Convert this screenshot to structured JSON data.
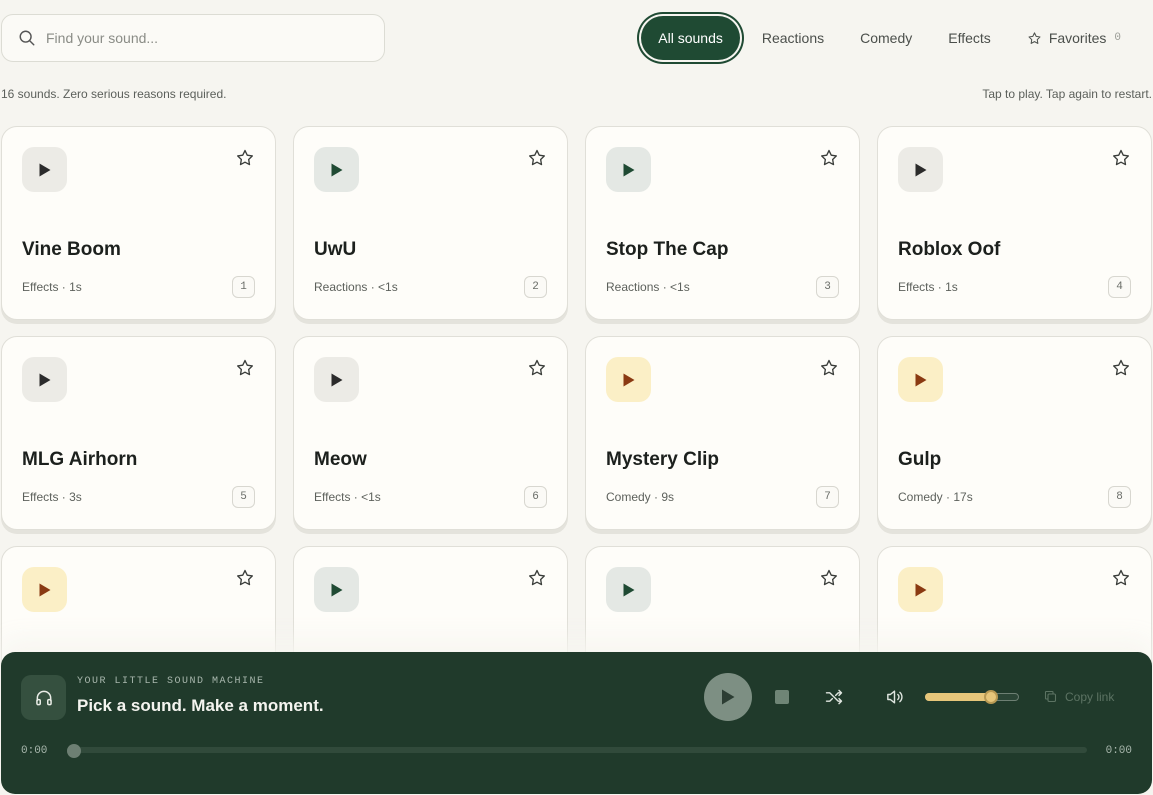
{
  "search": {
    "placeholder": "Find your sound..."
  },
  "filters": [
    {
      "label": "All sounds",
      "active": true
    },
    {
      "label": "Reactions",
      "active": false
    },
    {
      "label": "Comedy",
      "active": false
    },
    {
      "label": "Effects",
      "active": false
    }
  ],
  "favorites": {
    "label": "Favorites",
    "count": "0"
  },
  "summary": "16 sounds. Zero serious reasons required.",
  "hint": "Tap to play. Tap again to restart.",
  "cards": [
    {
      "name": "Vine Boom",
      "meta": "Effects · 1s",
      "index": "1",
      "tone": "grey"
    },
    {
      "name": "UwU",
      "meta": "Reactions · <1s",
      "index": "2",
      "tone": "green"
    },
    {
      "name": "Stop The Cap",
      "meta": "Reactions · <1s",
      "index": "3",
      "tone": "green"
    },
    {
      "name": "Roblox Oof",
      "meta": "Effects · 1s",
      "index": "4",
      "tone": "grey"
    },
    {
      "name": "MLG Airhorn",
      "meta": "Effects · 3s",
      "index": "5",
      "tone": "grey"
    },
    {
      "name": "Meow",
      "meta": "Effects · <1s",
      "index": "6",
      "tone": "grey"
    },
    {
      "name": "Mystery Clip",
      "meta": "Comedy · 9s",
      "index": "7",
      "tone": "gold"
    },
    {
      "name": "Gulp",
      "meta": "Comedy · 17s",
      "index": "8",
      "tone": "gold"
    },
    {
      "name": "",
      "meta": "",
      "index": "",
      "tone": "gold"
    },
    {
      "name": "",
      "meta": "",
      "index": "",
      "tone": "green"
    },
    {
      "name": "",
      "meta": "",
      "index": "",
      "tone": "green"
    },
    {
      "name": "",
      "meta": "",
      "index": "",
      "tone": "gold"
    }
  ],
  "player": {
    "kicker": "YOUR LITTLE SOUND MACHINE",
    "tagline": "Pick a sound. Make a moment.",
    "copy_label": "Copy link",
    "time_current": "0:00",
    "time_total": "0:00",
    "volume": 0.7,
    "progress": 0
  },
  "colors": {
    "accent": "#1f4a33",
    "player_bg": "#203a2b",
    "gold": "#e7c67a",
    "play_grey": "#2b2b2b",
    "play_green": "#1f4a33",
    "play_gold": "#8a3a12"
  },
  "icons": {
    "search": "search-icon",
    "star": "star-icon",
    "play": "play-icon",
    "headphones": "headphones-icon",
    "stop": "stop-icon",
    "shuffle": "shuffle-icon",
    "volume": "volume-icon",
    "copy": "copy-icon"
  }
}
